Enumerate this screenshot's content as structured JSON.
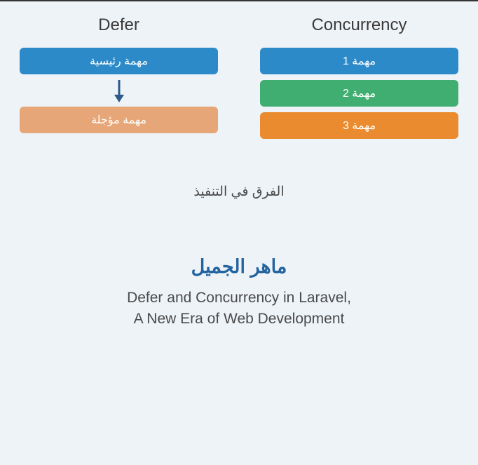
{
  "defer": {
    "title": "Defer",
    "main_task": "مهمة رئيسية",
    "deferred_task": "مهمة مؤجلة"
  },
  "concurrency": {
    "title": "Concurrency",
    "tasks": [
      "مهمة 1",
      "مهمة 2",
      "مهمة 3"
    ]
  },
  "difference_label": "الفرق في التنفيذ",
  "author": "ماهر الجميل",
  "subtitle_line1": "Defer and Concurrency in Laravel,",
  "subtitle_line2": "A New Era of Web Development",
  "colors": {
    "blue": "#2c8ac9",
    "green": "#3fae70",
    "orange": "#e98b2e",
    "orange_light": "#e6a677",
    "author_text": "#23639e"
  }
}
